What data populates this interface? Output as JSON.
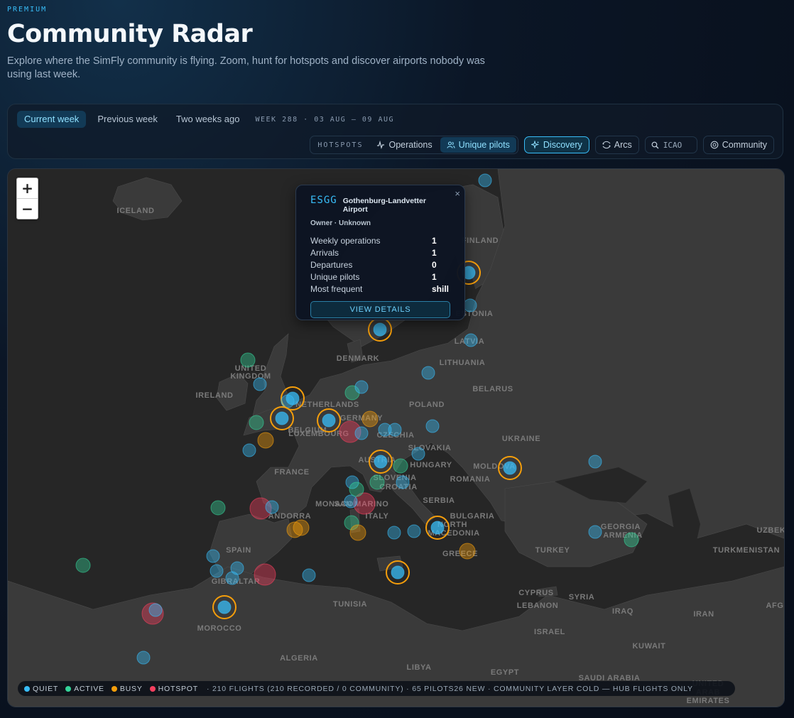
{
  "header": {
    "eyebrow": "PREMIUM",
    "title": "Community Radar",
    "subtitle": "Explore where the SimFly community is flying. Zoom, hunt for hotspots and discover airports nobody was using last week."
  },
  "toolbar": {
    "week_tabs": [
      "Current week",
      "Previous week",
      "Two weeks ago"
    ],
    "selected_week": "Current week",
    "week_label": "WEEK 288 · 03 AUG – 09 AUG",
    "hotspots_label": "HOTSPOTS",
    "operations_label": "Operations",
    "unique_pilots_label": "Unique pilots",
    "discovery_label": "Discovery",
    "arcs_label": "Arcs",
    "icao_placeholder": "ICAO",
    "community_label": "Community"
  },
  "map": {
    "zoom_in": "+",
    "zoom_out": "−",
    "labels": [
      "ICELAND",
      "FINLAND",
      "ESTONIA",
      "LATVIA",
      "LITHUANIA",
      "DENMARK",
      "UNITED",
      "KINGDOM",
      "IRELAND",
      "NETHERLANDS",
      "BELARUS",
      "POLAND",
      "GERMANY",
      "BELGIUM",
      "LUXEMBOURG",
      "CZECHIA",
      "SLOVAKIA",
      "UKRAINE",
      "FRANCE",
      "AUSTRIA",
      "HUNGARY",
      "MOLDOVA",
      "ROMANIA",
      "SLOVENIA",
      "CROATIA",
      "SERBIA",
      "MONACO",
      "SAN MARINO",
      "ANDORRA",
      "ITALY",
      "BULGARIA",
      "NORTH",
      "MACEDONIA",
      "GEORGIA",
      "ARMENIA",
      "UZBEK",
      "SPAIN",
      "GREECE",
      "TURKEY",
      "TURKMENISTAN",
      "GIBRALTAR",
      "TUNISIA",
      "CYPRUS",
      "SYRIA",
      "LEBANON",
      "IRAQ",
      "IRAN",
      "AFG",
      "MOROCCO",
      "ISRAEL",
      "KUWAIT",
      "ALGERIA",
      "LIBYA",
      "EGYPT",
      "SAUDI ARABIA",
      "UNITED",
      "ARAB",
      "EMIRATES"
    ]
  },
  "popup": {
    "icao": "ESGG",
    "name": "Gothenburg-Landvetter Airport",
    "owner": "Owner · Unknown",
    "close": "×",
    "rows": [
      {
        "label": "Weekly operations",
        "value": "1"
      },
      {
        "label": "Arrivals",
        "value": "1"
      },
      {
        "label": "Departures",
        "value": "0"
      },
      {
        "label": "Unique pilots",
        "value": "1"
      },
      {
        "label": "Most frequent",
        "value": "shill"
      }
    ],
    "button": "VIEW DETAILS"
  },
  "legend": {
    "items": [
      {
        "label": "QUIET",
        "color": "#38bdf8"
      },
      {
        "label": "ACTIVE",
        "color": "#34d399"
      },
      {
        "label": "BUSY",
        "color": "#f59e0b"
      },
      {
        "label": "HOTSPOT",
        "color": "#f43f5e"
      }
    ],
    "stats": "· 210 FLIGHTS (210 RECORDED / 0 COMMUNITY) · 65 PILOTS26 NEW  · COMMUNITY LAYER COLD — HUB FLIGHTS ONLY"
  },
  "colors": {
    "quiet": "#38bdf8",
    "active": "#34d399",
    "busy": "#f59e0b",
    "hotspot": "#f43f5e",
    "land": "#3a3a3a",
    "sea": "#262626"
  }
}
